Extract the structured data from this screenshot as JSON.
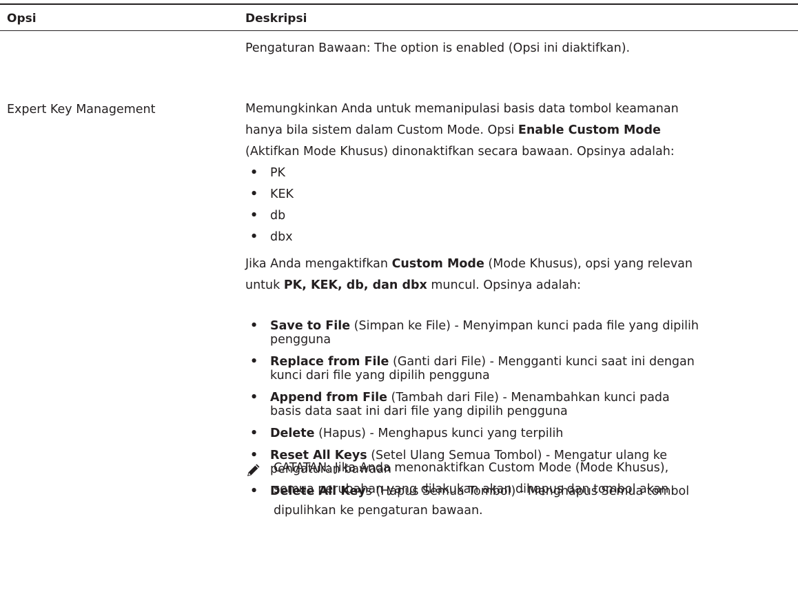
{
  "table": {
    "headers": {
      "option": "Opsi",
      "description": "Deskripsi"
    },
    "default_row": {
      "text": "Pengaturan Bawaan: The option is enabled (Opsi ini diaktifkan)."
    },
    "expert_row": {
      "label": "Expert Key Management",
      "intro_1": "Memungkinkan Anda untuk memanipulasi basis data tombol keamanan",
      "intro_2a": "hanya bila sistem dalam Custom Mode. Opsi ",
      "intro_2b": "Enable Custom Mode",
      "intro_3": "(Aktifkan Mode Khusus) dinonaktifkan secara bawaan. Opsinya adalah:",
      "key_list": [
        "PK",
        "KEK",
        "db",
        "dbx"
      ],
      "custom_1a": "Jika Anda mengaktifkan ",
      "custom_1b": "Custom Mode",
      "custom_1c": " (Mode Khusus), opsi yang relevan",
      "custom_2a": "untuk ",
      "custom_2b": "PK, KEK, db, dan dbx",
      "custom_2c": " muncul. Opsinya adalah:",
      "actions": [
        {
          "bold": "Save to File",
          "rest1": " (Simpan ke File) - Menyimpan kunci pada file yang dipilih",
          "rest2": "pengguna"
        },
        {
          "bold": "Replace from File",
          "rest1": " (Ganti dari File) - Mengganti kunci saat ini dengan",
          "rest2": "kunci dari file yang dipilih pengguna"
        },
        {
          "bold": "Append from File",
          "rest1": " (Tambah dari File) - Menambahkan kunci pada",
          "rest2": "basis data saat ini dari file yang dipilih pengguna"
        },
        {
          "bold": "Delete",
          "rest1": " (Hapus) - Menghapus kunci yang terpilih",
          "rest2": ""
        },
        {
          "bold": "Reset All Keys",
          "rest1": " (Setel Ulang Semua Tombol) - Mengatur ulang ke",
          "rest2": "pengaturan bawaan"
        },
        {
          "bold": "Delete All Key",
          "rest1": "s (Hapus Semua Tombol) - Menghapus Semua tombol",
          "rest2": ""
        }
      ],
      "note": {
        "title": "CATATAN:",
        "line1": " Jika Anda menonaktifkan Custom Mode (Mode Khusus),",
        "line2": "semua perubahan yang dilakukan akan dihapus dan tombol akan",
        "line3": "dipulihkan ke pengaturan bawaan."
      }
    }
  },
  "colors": {
    "text": "#231f20",
    "rule": "#231f20"
  },
  "icons": {
    "note": "pencil-note-icon"
  }
}
